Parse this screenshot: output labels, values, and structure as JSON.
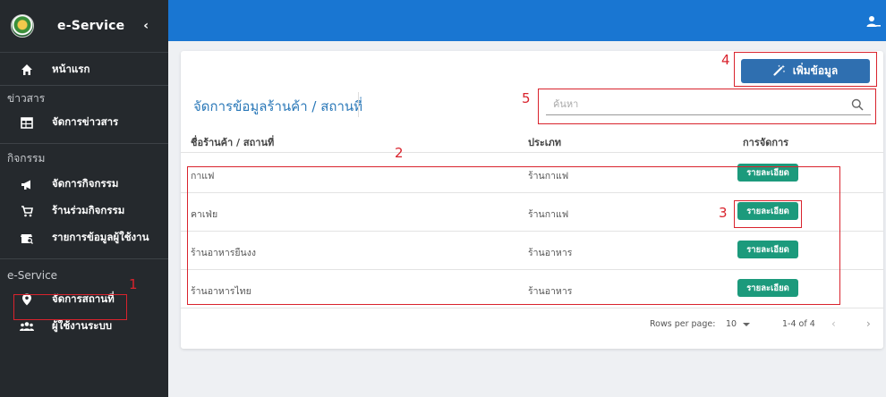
{
  "app": {
    "title": "e-Service",
    "collapse_glyph": "‹"
  },
  "sidebar": {
    "items": [
      {
        "label": "หน้าแรก",
        "icon": "home-icon"
      },
      {
        "section": "ข่าวสาร"
      },
      {
        "label": "จัดการข่าวสาร",
        "icon": "news-table-icon"
      },
      {
        "section": "กิจกรรม"
      },
      {
        "label": "จัดการกิจกรรม",
        "icon": "megaphone-icon"
      },
      {
        "label": "ร้านร่วมกิจกรรม",
        "icon": "cart-icon"
      },
      {
        "label": "รายการข้อมูลผู้ใช้งาน",
        "icon": "store-search-icon"
      },
      {
        "section": "e-Service"
      },
      {
        "label": "จัดการสถานที่",
        "icon": "location-pin-icon",
        "active": true
      },
      {
        "label": "ผู้ใช้งานระบบ",
        "icon": "users-icon"
      }
    ]
  },
  "header": {
    "user_icon": "user-add-icon"
  },
  "main": {
    "title": "จัดการข้อมูลร้านค้า / สถานที่",
    "add_button_label": "เพิ่มข้อมูล",
    "search_placeholder": "ค้นหา",
    "table": {
      "columns": [
        "ชื่อร้านค้า / สถานที่",
        "ประเภท",
        "การจัดการ"
      ],
      "rows": [
        {
          "name": "กาแฟ",
          "type": "ร้านกาแฟ",
          "action": "รายละเอียด"
        },
        {
          "name": "คาเฟ่ย",
          "type": "ร้านกาแฟ",
          "action": "รายละเอียด"
        },
        {
          "name": "ร้านอาหารยืนงง",
          "type": "ร้านอาหาร",
          "action": "รายละเอียด"
        },
        {
          "name": "ร้านอาหารไทย",
          "type": "ร้านอาหาร",
          "action": "รายละเอียด"
        }
      ]
    },
    "pagination": {
      "rows_per_page_label": "Rows per page:",
      "rows_per_page": "10",
      "range": "1-4 of 4",
      "prev": "‹",
      "next": "›"
    }
  },
  "annotations": [
    "1",
    "2",
    "3",
    "4",
    "5"
  ],
  "colors": {
    "sidebar": "#25292d",
    "topbar": "#1976d2",
    "primary_button": "#2f6fb0",
    "detail_button": "#1c9a7c",
    "annotation": "#d9232d"
  }
}
